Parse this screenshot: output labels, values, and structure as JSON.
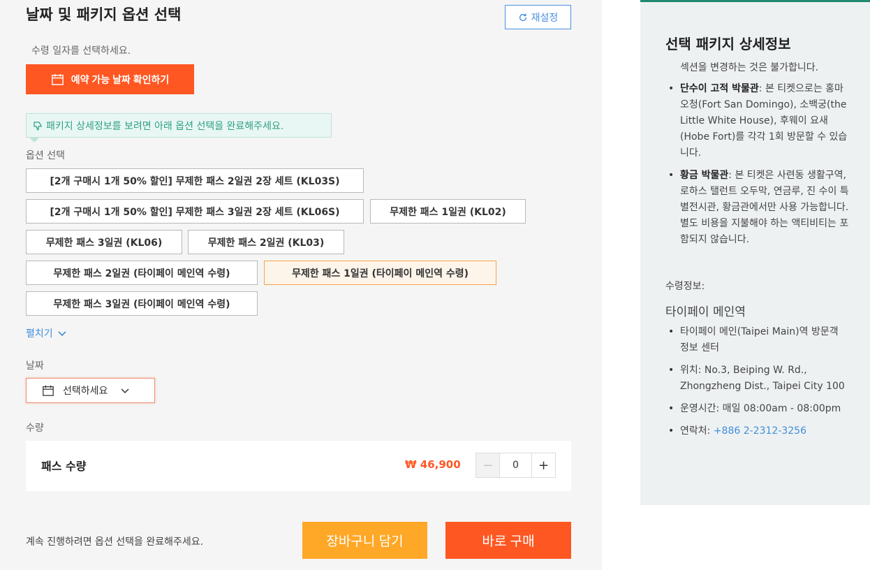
{
  "header": {
    "title": "날짜 및 패키지 옵션 선택",
    "reset_label": "재설정"
  },
  "receipt": {
    "hint": "수령 일자를 선택하세요.",
    "check_dates_label": "예약 가능 날짜 확인하기"
  },
  "notice": "패키지 상세정보를 보려면 아래 옵션 선택을 완료해주세요.",
  "options": {
    "label": "옵션 선택",
    "items": [
      "[2개 구매시 1개 50% 할인] 무제한 패스 2일권 2장 세트 (KL03S)",
      "[2개 구매시 1개 50% 할인] 무제한 패스 3일권 2장 세트 (KL06S)",
      "무제한 패스 1일권 (KL02)",
      "무제한 패스 3일권 (KL06)",
      "무제한 패스 2일권 (KL03)",
      "무제한 패스 2일권 (타이페이 메인역 수령)",
      "무제한 패스 1일권 (타이페이 메인역 수령)",
      "무제한 패스 3일권 (타이페이 메인역 수령)"
    ],
    "selected_index": 6,
    "expand_label": "펼치기"
  },
  "date": {
    "label": "날짜",
    "placeholder": "선택하세요"
  },
  "quantity": {
    "section_label": "수량",
    "item_label": "패스 수량",
    "price": "₩ 46,900",
    "minus": "−",
    "value": "0",
    "plus": "+"
  },
  "footer": {
    "note": "계속 진행하려면 옵션 선택을 완료해주세요.",
    "cart_label": "장바구니 담기",
    "buy_label": "바로 구매"
  },
  "details_panel": {
    "title": "선택 패키지 상세정보",
    "subtitle": "섹션을 변경하는 것은 불가합니다.",
    "museums": [
      {
        "bold": "단수이 고적 박물관",
        "text": ": 본 티켓으로는 홍마오청(Fort San Domingo), 소백궁(the Little White House), 후웨이 요새(Hobe Fort)를 각각 1회 방문할 수 있습니다."
      },
      {
        "bold": "황금 박물관",
        "text": ": 본 티켓은 사련동 생활구역, 로하스 탤런트 오두막, 연금루, 진 수이 특별전시관, 황금관에서만 사용 가능합니다. 별도 비용을 지불해야 하는 액티비티는 포함되지 않습니다."
      }
    ],
    "receiving_label": "수령정보:",
    "station": "타이페이 메인역",
    "info": {
      "place": "타이페이 메인(Taipei Main)역 방문객 정보 센터",
      "location": "위치: No.3, Beiping W. Rd., Zhongzheng Dist., Taipei City 100",
      "hours": "운영시간: 매일 08:00am - 08:00pm",
      "contact_label": "연락처: ",
      "contact_phone": "+886 2-2312-3256"
    }
  },
  "colors": {
    "primary_orange": "#ff5722",
    "cart_orange": "#ffa726",
    "link_blue": "#3f8ed8",
    "notice_green": "#2f9f84",
    "panel_accent": "#1f8a70"
  }
}
